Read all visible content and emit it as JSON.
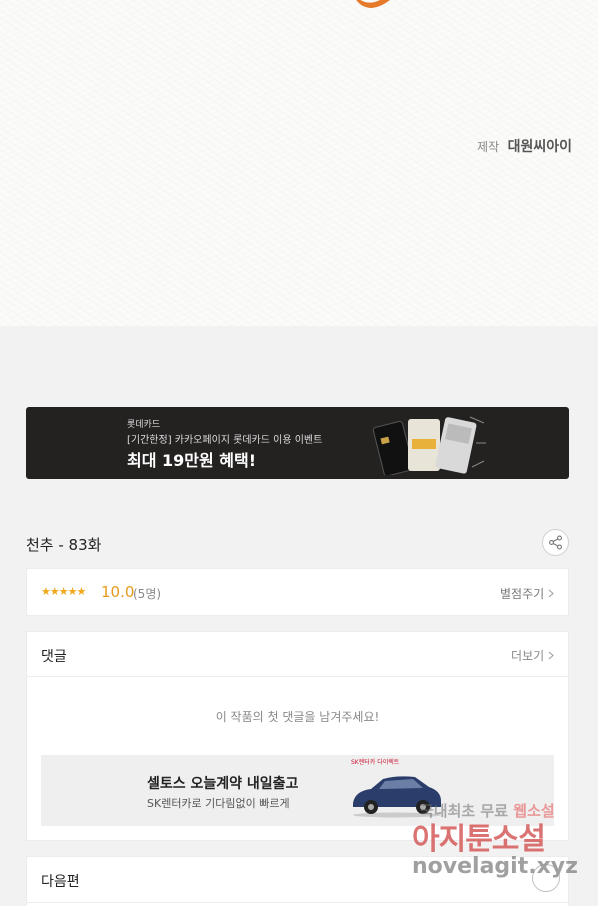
{
  "credit": {
    "label": "제작",
    "value": "대원씨아이"
  },
  "banner": {
    "brand": "롯데카드",
    "subtitle": "[기간한정] 카카오페이지 롯데카드 이용 이벤트",
    "headline": "최대 19만원 혜택!"
  },
  "episode": {
    "title": "천추 - 83화"
  },
  "rating": {
    "stars": "★★★★★",
    "score": "10.0",
    "count": "(5명)",
    "rate_link": "별점주기"
  },
  "comments": {
    "header": "댓글",
    "more": "더보기",
    "empty_message": "이 작품의 첫 댓글을 남겨주세요!"
  },
  "ad": {
    "title": "셀토스 오늘계약 내일출고",
    "subtitle": "SK렌터카로 기다림없이 빠르게",
    "brand": "SK렌터카 다이렉트"
  },
  "next": {
    "title": "다음편"
  },
  "watermark": {
    "line1a": "국내최초 무료",
    "line1b": "웹소설",
    "line2": "아지툰소설",
    "line3": "novelagit.xyz"
  },
  "colors": {
    "accent_rating": "#e59a1b",
    "banner_bg": "#242121"
  },
  "icons": {
    "share": "share-icon",
    "chevron": "chevron-right-icon"
  }
}
